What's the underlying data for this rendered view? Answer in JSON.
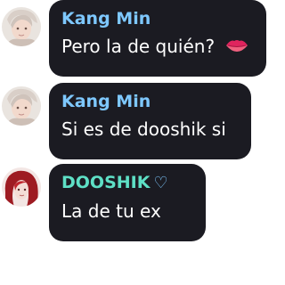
{
  "colors": {
    "bubble_bg": "#1b1b22",
    "name_kang": "#7ec8ff",
    "name_dooshik": "#5ee0c6",
    "message_text": "#ffffff"
  },
  "messages": [
    {
      "sender": "Kang Min",
      "text": "Pero la de quién?",
      "emoji": "lips-icon",
      "avatar": "avatar-kang-min"
    },
    {
      "sender": "Kang Min",
      "text": "Si es de dooshik si",
      "avatar": "avatar-kang-min"
    },
    {
      "sender": "DOOSHIK",
      "sender_suffix": "♡",
      "text": "La de tu ex",
      "avatar": "avatar-dooshik"
    }
  ]
}
